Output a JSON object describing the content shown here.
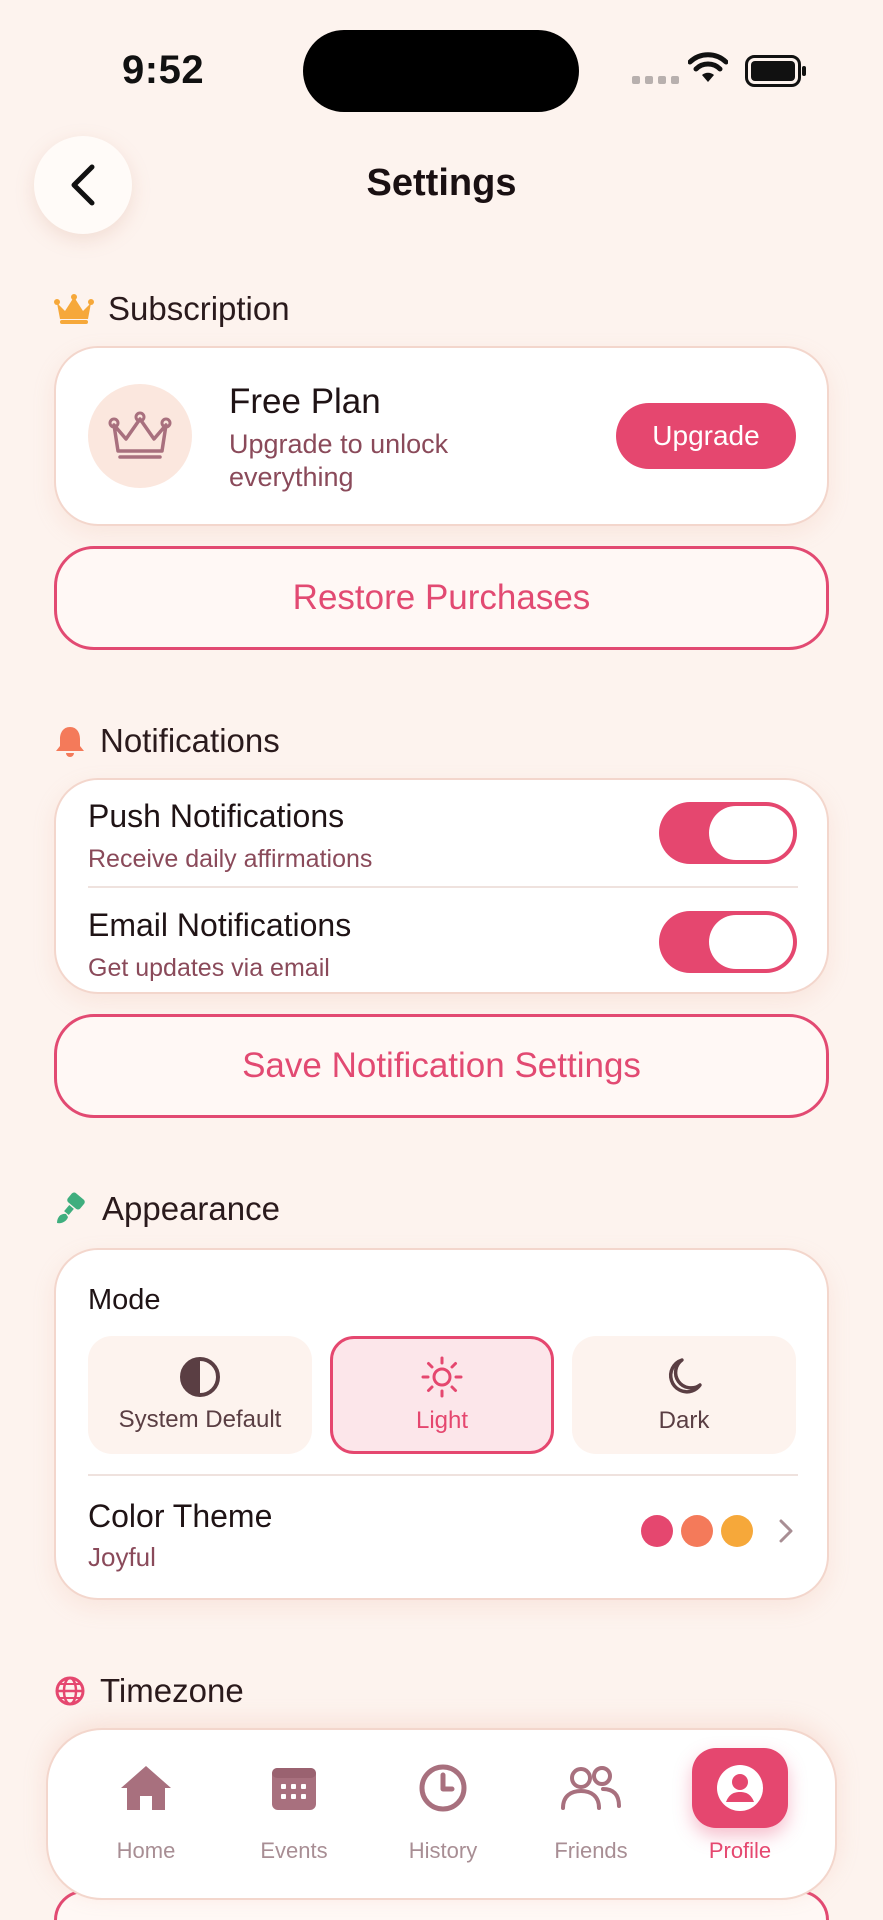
{
  "status_bar": {
    "time": "9:52"
  },
  "header": {
    "title": "Settings",
    "back_icon": "chevron-left-icon"
  },
  "subscription": {
    "section_label": "Subscription",
    "icon": "crown-icon",
    "plan_name": "Free Plan",
    "plan_desc": "Upgrade to unlock everything",
    "upgrade_label": "Upgrade",
    "restore_label": "Restore Purchases"
  },
  "notifications": {
    "section_label": "Notifications",
    "icon": "bell-icon",
    "items": [
      {
        "title": "Push Notifications",
        "subtitle": "Receive daily affirmations",
        "enabled": true
      },
      {
        "title": "Email Notifications",
        "subtitle": "Get updates via email",
        "enabled": true
      }
    ],
    "save_label": "Save Notification Settings"
  },
  "appearance": {
    "section_label": "Appearance",
    "icon": "paintbrush-icon",
    "mode_label": "Mode",
    "modes": [
      {
        "label": "System Default",
        "icon": "half-circle-icon",
        "selected": false
      },
      {
        "label": "Light",
        "icon": "sun-icon",
        "selected": true
      },
      {
        "label": "Dark",
        "icon": "moon-icon",
        "selected": false
      }
    ],
    "color_theme_title": "Color Theme",
    "color_theme_value": "Joyful",
    "swatch_colors": [
      "#E5476F",
      "#F47A5A",
      "#F6A83A"
    ]
  },
  "timezone": {
    "section_label": "Timezone",
    "icon": "globe-icon"
  },
  "bottom_nav": {
    "items": [
      {
        "label": "Home",
        "icon": "home-icon",
        "active": false
      },
      {
        "label": "Events",
        "icon": "calendar-icon",
        "active": false
      },
      {
        "label": "History",
        "icon": "clock-icon",
        "active": false
      },
      {
        "label": "Friends",
        "icon": "friends-icon",
        "active": false
      },
      {
        "label": "Profile",
        "icon": "profile-icon",
        "active": true
      }
    ]
  },
  "colors": {
    "accent": "#E5476F",
    "background": "#FDF3EE",
    "subtext": "#8A4A5A"
  }
}
